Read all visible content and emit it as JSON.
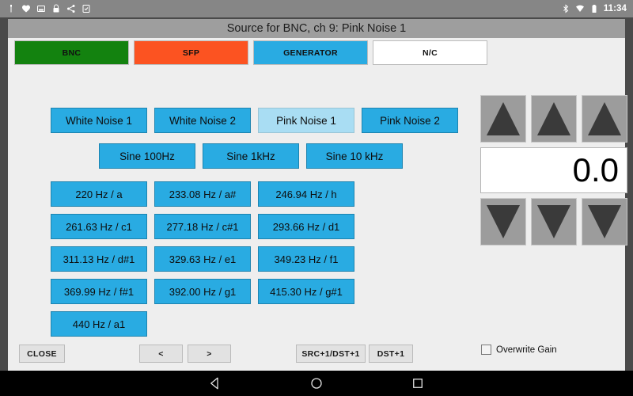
{
  "status_bar": {
    "left_icons": [
      "usb-icon",
      "heart-icon",
      "sd-card-icon",
      "lock-icon",
      "share-icon",
      "screenshot-icon"
    ],
    "right_icons": [
      "bluetooth-icon",
      "wifi-icon",
      "battery-icon"
    ],
    "clock": "11:34"
  },
  "window": {
    "title": "Source for BNC, ch 9: Pink Noise 1"
  },
  "tabs": [
    {
      "label": "BNC",
      "color": "#13820f",
      "selected": false
    },
    {
      "label": "SFP",
      "color": "#fc5321",
      "selected": false
    },
    {
      "label": "GENERATOR",
      "color": "#29abe2",
      "selected": false
    },
    {
      "label": "N/C",
      "color": "#ffffff",
      "selected": false
    }
  ],
  "noise_buttons": [
    {
      "label": "White Noise 1",
      "selected": false
    },
    {
      "label": "White Noise 2",
      "selected": false
    },
    {
      "label": "Pink Noise 1",
      "selected": true
    },
    {
      "label": "Pink Noise 2",
      "selected": false
    }
  ],
  "sine_buttons": [
    {
      "label": "Sine 100Hz",
      "selected": false
    },
    {
      "label": "Sine 1kHz",
      "selected": false
    },
    {
      "label": "Sine 10 kHz",
      "selected": false
    }
  ],
  "frequency_buttons": [
    {
      "label": "220 Hz / a",
      "selected": false
    },
    {
      "label": "233.08 Hz / a#",
      "selected": false
    },
    {
      "label": "246.94 Hz / h",
      "selected": false
    },
    {
      "label": "261.63 Hz / c1",
      "selected": false
    },
    {
      "label": "277.18 Hz / c#1",
      "selected": false
    },
    {
      "label": "293.66 Hz / d1",
      "selected": false
    },
    {
      "label": "311.13 Hz / d#1",
      "selected": false
    },
    {
      "label": "329.63 Hz / e1",
      "selected": false
    },
    {
      "label": "349.23 Hz / f1",
      "selected": false
    },
    {
      "label": "369.99 Hz / f#1",
      "selected": false
    },
    {
      "label": "392.00 Hz / g1",
      "selected": false
    },
    {
      "label": "415.30 Hz / g#1",
      "selected": false
    },
    {
      "label": "440 Hz / a1",
      "selected": false
    }
  ],
  "gain_panel": {
    "increment_buttons": [
      "gain-up-coarse",
      "gain-up-medium",
      "gain-up-fine"
    ],
    "decrement_buttons": [
      "gain-down-coarse",
      "gain-down-medium",
      "gain-down-fine"
    ],
    "value": "0.0"
  },
  "bottom_bar": {
    "close_label": "CLOSE",
    "prev_label": "<",
    "next_label": ">",
    "src_dst_label": "SRC+1/DST+1",
    "dst_label": "DST+1",
    "overwrite_gain_label": "Overwrite Gain",
    "overwrite_gain_checked": false
  },
  "nav_bar": {
    "back": "back-icon",
    "home": "home-icon",
    "recents": "recents-icon"
  },
  "colors": {
    "accent_blue": "#29abe2",
    "selected_blue": "#a9ddf3",
    "bnc_green": "#13820f",
    "sfp_orange": "#fc5321",
    "window_bg": "#eeeeee",
    "title_bg": "#9e9e9e"
  }
}
